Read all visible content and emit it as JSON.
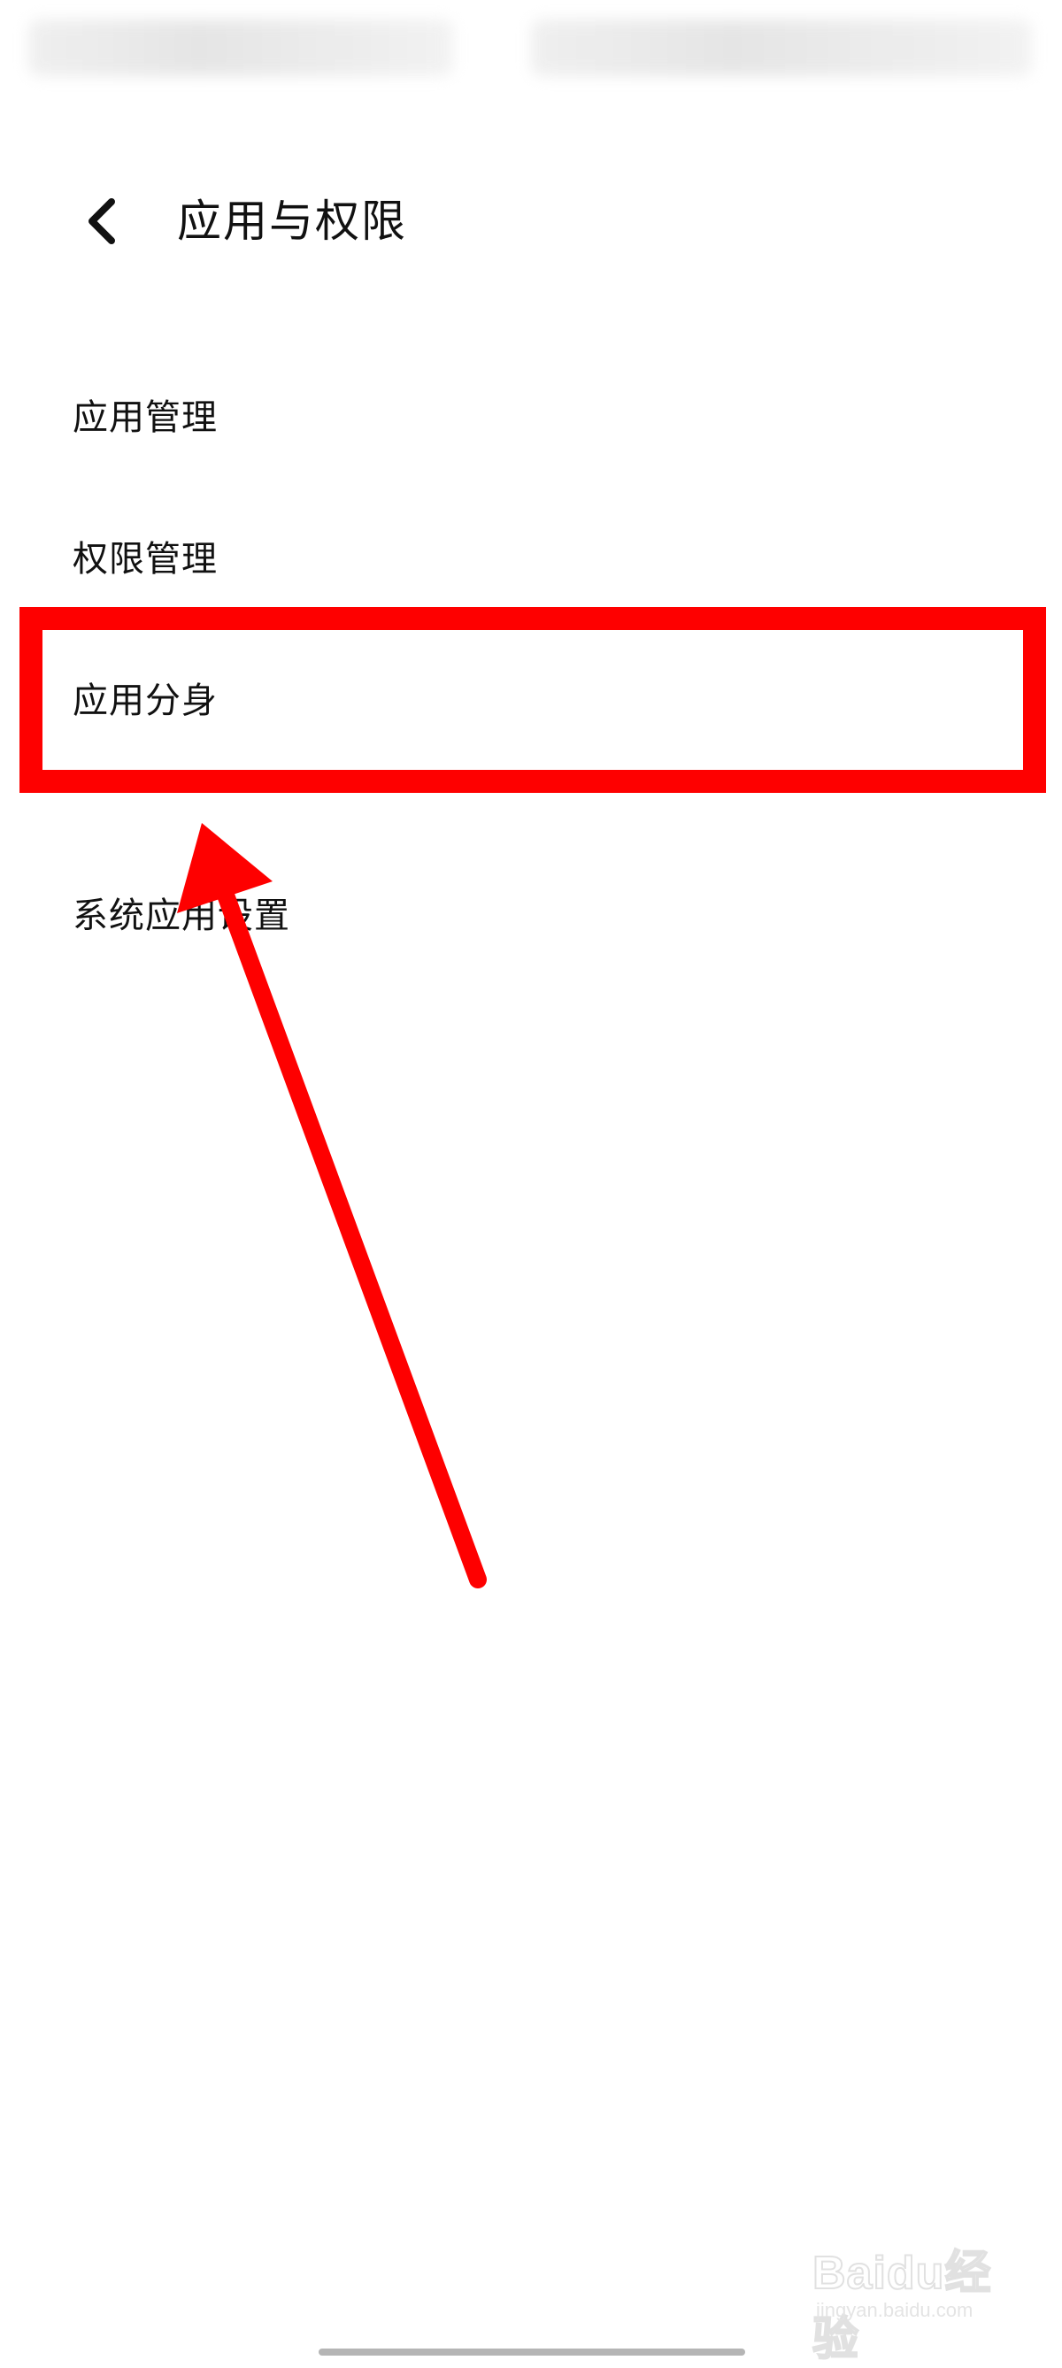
{
  "header": {
    "title": "应用与权限",
    "back_icon": "chevron-left-icon"
  },
  "menu": {
    "items": [
      {
        "label": "应用管理"
      },
      {
        "label": "权限管理"
      },
      {
        "label": "应用分身"
      },
      {
        "label": "系统应用设置"
      }
    ]
  },
  "annotation": {
    "color": "#fe0000",
    "highlighted_item": "应用分身"
  },
  "watermark": {
    "main": "Baidu经验",
    "sub": "jingyan.baidu.com"
  }
}
